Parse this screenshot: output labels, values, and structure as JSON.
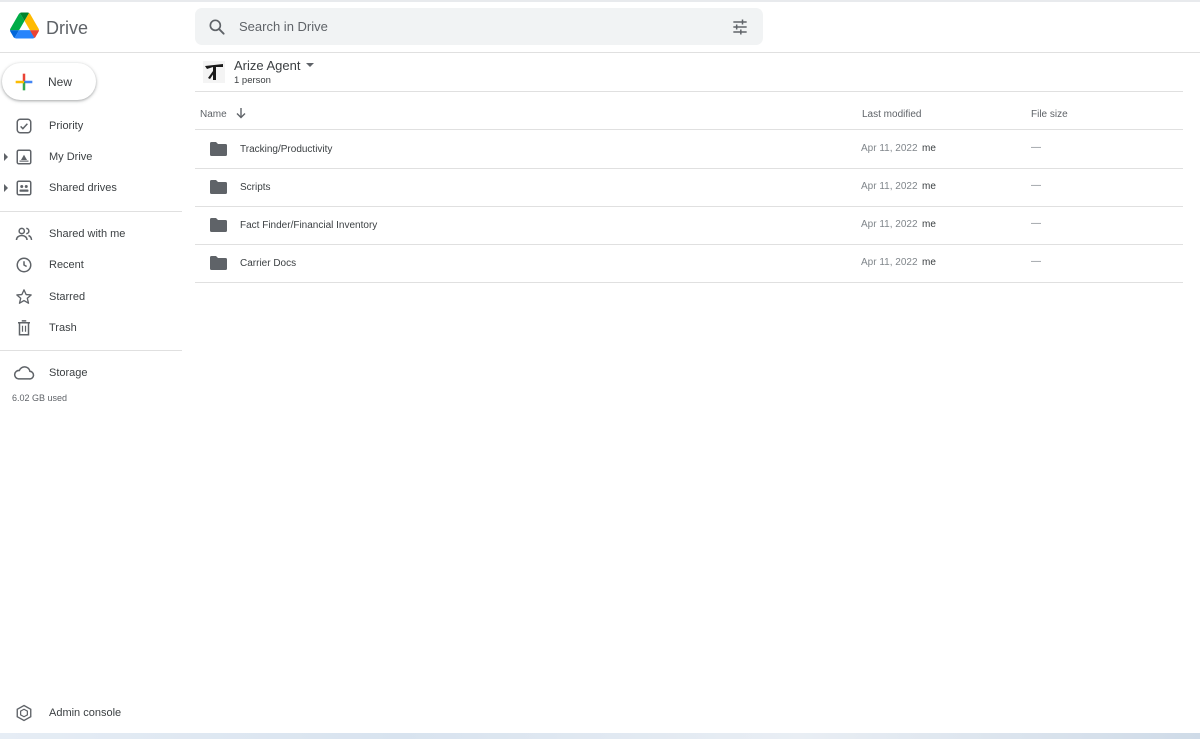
{
  "app": {
    "name": "Drive"
  },
  "search": {
    "placeholder": "Search in Drive"
  },
  "sidebar": {
    "new_label": "New",
    "items": [
      {
        "label": "Priority",
        "icon": "priority-check-icon"
      },
      {
        "label": "My Drive",
        "icon": "my-drive-icon"
      },
      {
        "label": "Shared drives",
        "icon": "shared-drives-icon"
      },
      {
        "label": "Shared with me",
        "icon": "people-icon"
      },
      {
        "label": "Recent",
        "icon": "clock-icon"
      },
      {
        "label": "Starred",
        "icon": "star-icon"
      },
      {
        "label": "Trash",
        "icon": "trash-icon"
      }
    ],
    "storage": {
      "label": "Storage",
      "used": "6.02 GB used",
      "icon": "cloud-icon"
    },
    "admin_label": "Admin console"
  },
  "main": {
    "account": {
      "name": "Arize Agent",
      "members": "1 person"
    },
    "columns": {
      "name": "Name",
      "modified": "Last modified",
      "size": "File size"
    },
    "rows": [
      {
        "name": "Tracking/Productivity",
        "date": "Apr 11, 2022",
        "owner": "me",
        "size": "—"
      },
      {
        "name": "Scripts",
        "date": "Apr 11, 2022",
        "owner": "me",
        "size": "—"
      },
      {
        "name": "Fact Finder/Financial Inventory",
        "date": "Apr 11, 2022",
        "owner": "me",
        "size": "—"
      },
      {
        "name": "Carrier Docs",
        "date": "Apr 11, 2022",
        "owner": "me",
        "size": "—"
      }
    ]
  },
  "colors": {
    "icon": "#5f6368",
    "text": "#3c4043",
    "search_bg": "#f1f3f4",
    "divider": "#e0e0e0"
  }
}
